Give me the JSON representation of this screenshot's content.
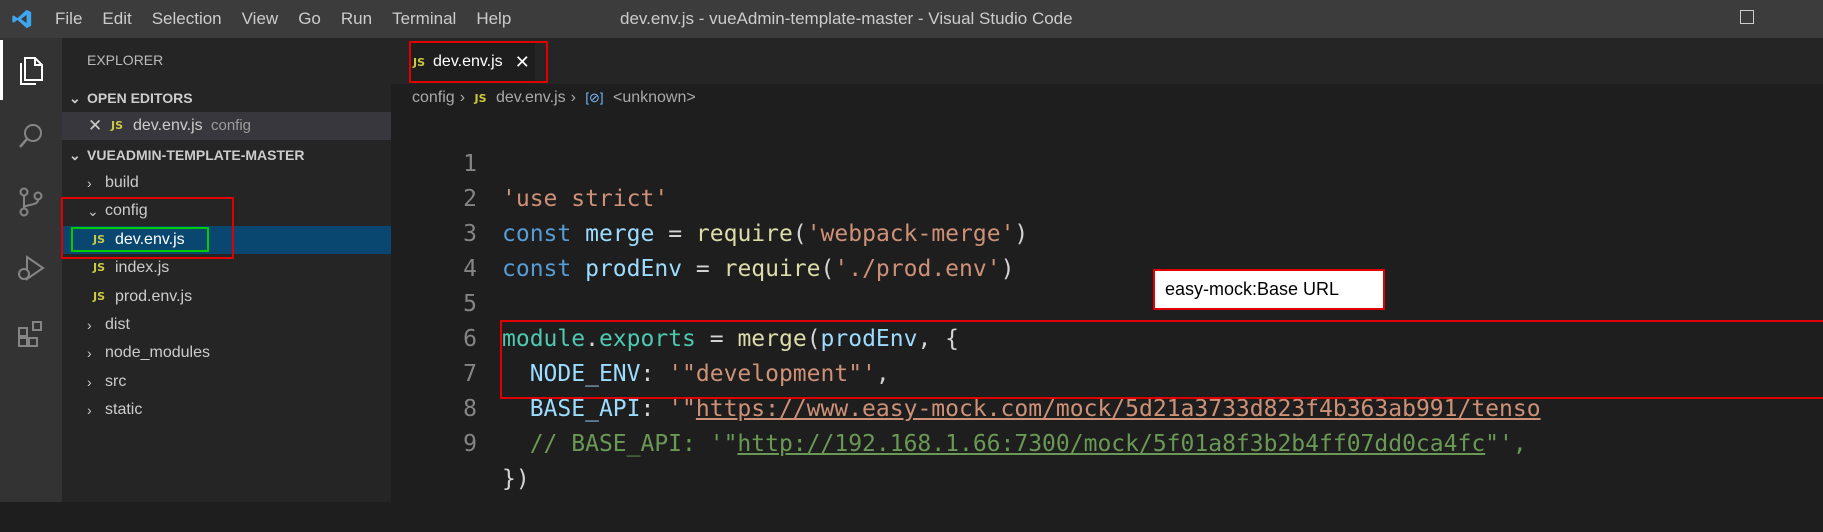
{
  "window": {
    "title": "dev.env.js - vueAdmin-template-master - Visual Studio Code",
    "menu": [
      "File",
      "Edit",
      "Selection",
      "View",
      "Go",
      "Run",
      "Terminal",
      "Help"
    ]
  },
  "activity_bar": {
    "icons": [
      "explorer-icon",
      "search-icon",
      "source-control-icon",
      "run-debug-icon",
      "extensions-icon"
    ]
  },
  "sidebar": {
    "title": "EXPLORER",
    "open_editors": {
      "label": "OPEN EDITORS",
      "files": [
        {
          "icon": "JS",
          "name": "dev.env.js",
          "folder": "config"
        }
      ]
    },
    "project": {
      "label": "VUEADMIN-TEMPLATE-MASTER",
      "tree": [
        {
          "name": "build",
          "type": "folder",
          "expanded": false
        },
        {
          "name": "config",
          "type": "folder",
          "expanded": true
        },
        {
          "name": "dev.env.js",
          "type": "file",
          "icon": "JS",
          "selected": true
        },
        {
          "name": "index.js",
          "type": "file",
          "icon": "JS"
        },
        {
          "name": "prod.env.js",
          "type": "file",
          "icon": "JS"
        },
        {
          "name": "dist",
          "type": "folder",
          "expanded": false
        },
        {
          "name": "node_modules",
          "type": "folder",
          "expanded": false
        },
        {
          "name": "src",
          "type": "folder",
          "expanded": false
        },
        {
          "name": "static",
          "type": "folder",
          "expanded": false
        }
      ]
    }
  },
  "editor": {
    "tab": {
      "icon": "JS",
      "name": "dev.env.js"
    },
    "breadcrumb": [
      "config",
      "dev.env.js",
      "<unknown>"
    ],
    "lines": {
      "n1": "1",
      "n2": "2",
      "n3": "3",
      "n4": "4",
      "n5": "5",
      "n6": "6",
      "n7": "7",
      "n8": "8",
      "n9": "9",
      "l1": "'use strict'",
      "l2_kw": "const",
      "l2_var": "merge",
      "l2_eq": " = ",
      "l2_fn": "require",
      "l2_p1": "(",
      "l2_str": "'webpack-merge'",
      "l2_p2": ")",
      "l3_kw": "const",
      "l3_var": "prodEnv",
      "l3_eq": " = ",
      "l3_fn": "require",
      "l3_p1": "(",
      "l3_str": "'./prod.env'",
      "l3_p2": ")",
      "l5_obj": "module",
      "l5_dot": ".",
      "l5_prop": "exports",
      "l5_eq": " = ",
      "l5_fn": "merge",
      "l5_p1": "(",
      "l5_var": "prodEnv",
      "l5_rest": ", {",
      "l6_key": "NODE_ENV",
      "l6_col": ": ",
      "l6_str": "'\"development\"'",
      "l6_comma": ",",
      "l7_key": "BASE_API",
      "l7_col": ": ",
      "l7_q": "'\"",
      "l7_url": "https://www.easy-mock.com/mock/5d21a3733d823f4b363ab991/tenso",
      "l8": "// BASE_API: '\"",
      "l8_url": "http://192.168.1.66:7300/mock/5f01a8f3b2b4ff07dd0ca4fc",
      "l8_end": "\"',",
      "l9": "})"
    }
  },
  "annotations": {
    "callout": "easy-mock:Base URL",
    "colors": {
      "red": "#e00000",
      "green": "#00cc00"
    }
  }
}
